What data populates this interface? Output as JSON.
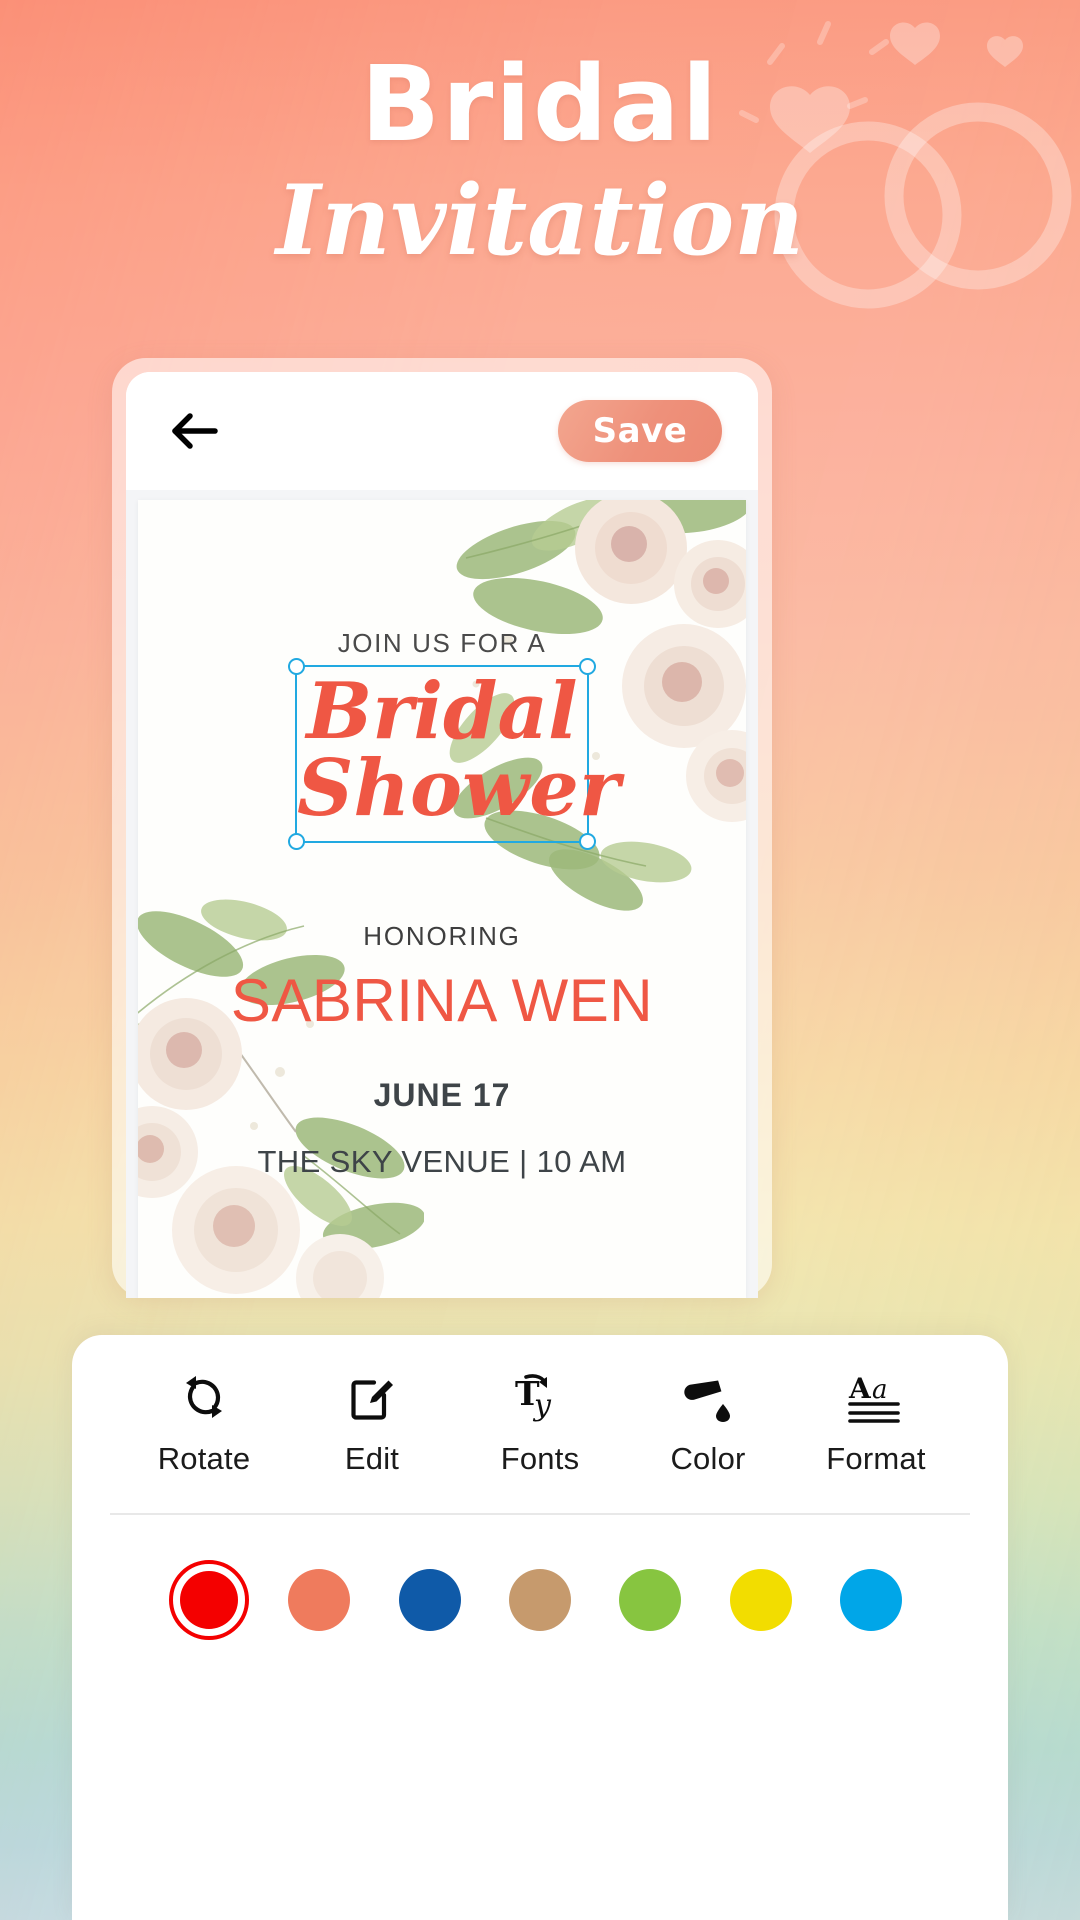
{
  "page": {
    "title_main": "Bridal",
    "title_sub": "Invitation"
  },
  "app_bar": {
    "back_icon": "arrow-left-icon",
    "save_label": "Save"
  },
  "invitation": {
    "join_us": "JOIN US FOR A",
    "script_line_1": "Bridal",
    "script_line_2": "Shower",
    "honoring_label": "HONORING",
    "honoree": "SABRINA WEN",
    "date": "JUNE 17",
    "venue": "THE SKY VENUE | 10 AM"
  },
  "editor": {
    "tools": [
      {
        "label": "Rotate",
        "icon": "rotate-icon"
      },
      {
        "label": "Edit",
        "icon": "edit-pencil-icon"
      },
      {
        "label": "Fonts",
        "icon": "fonts-ty-icon"
      },
      {
        "label": "Color",
        "icon": "paint-bucket-icon"
      },
      {
        "label": "Format",
        "icon": "format-aa-icon"
      }
    ],
    "swatches": [
      {
        "color": "#f40000",
        "selected": true
      },
      {
        "color": "#ef7b5d",
        "selected": false
      },
      {
        "color": "#0f5aa8",
        "selected": false
      },
      {
        "color": "#c69a6d",
        "selected": false
      },
      {
        "color": "#87c540",
        "selected": false
      },
      {
        "color": "#f2dd00",
        "selected": false
      },
      {
        "color": "#00a6e8",
        "selected": false
      }
    ]
  },
  "colors": {
    "accent_coral": "#ef5744",
    "save_button": "#ee907a",
    "selection_blue": "#21a9e1"
  }
}
